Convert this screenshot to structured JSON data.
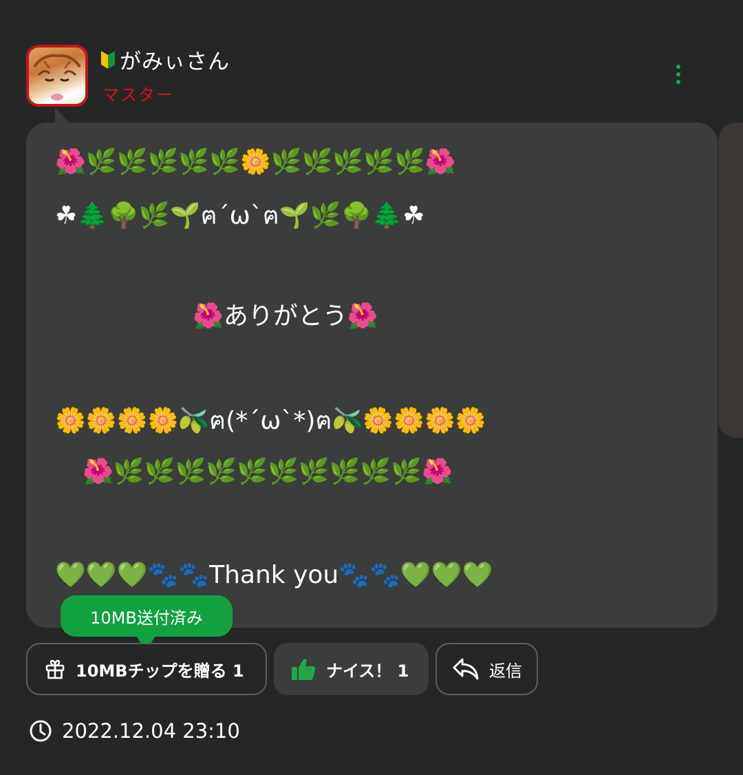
{
  "post": {
    "author": {
      "name": "がみぃさん",
      "role": "マスター",
      "badge_icon": "beginner-mark-icon"
    },
    "message_lines": [
      "🌺🌿🌿🌿🌿🌿🌼🌿🌿🌿🌿🌿🌺",
      "☘🌲🌳🌿🌱ฅ´ω`ฅ🌱🌿🌳🌲☘",
      "🌺ありがとう🌺",
      "🌼🌼🌼🌼🫒ฅ(*´ω`*)ฅ🫒🌼🌼🌼🌼",
      "🌺🌿🌿🌿🌿🌿🌿🌿🌿🌿🌿🌺",
      "💚💚💚🐾🐾Thank you🐾🐾💚💚💚"
    ],
    "tip_tooltip": "10MB送付済み",
    "actions": {
      "tip_label": "10MBチップを贈る",
      "tip_count": "1",
      "like_label": "ナイス！",
      "like_count": "1",
      "reply_label": "返信"
    },
    "timestamp": "2022.12.04 23:10"
  },
  "colors": {
    "background": "#252726",
    "bubble": "#3a3d3b",
    "accent_green": "#12a140",
    "role_red": "#d3131b"
  }
}
